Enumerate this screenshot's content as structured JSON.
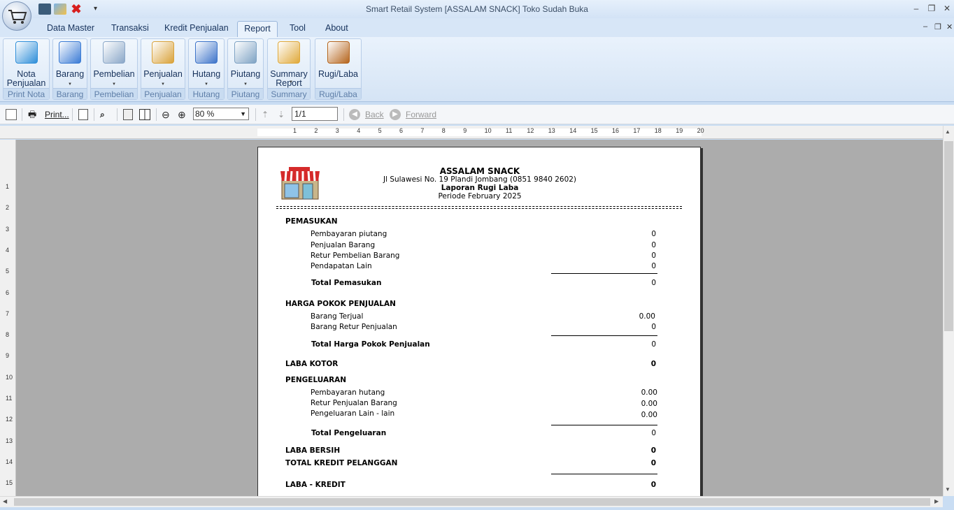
{
  "window": {
    "title": "Smart Retail System [ASSALAM SNACK] Toko Sudah Buka",
    "minimize": "–",
    "restore": "❐",
    "close": "✕",
    "qat_dropdown": "▾"
  },
  "tabs": [
    {
      "label": "Data Master"
    },
    {
      "label": "Transaksi"
    },
    {
      "label": "Kredit Penjualan"
    },
    {
      "label": "Report",
      "active": true
    },
    {
      "label": "Tool"
    },
    {
      "label": "About"
    }
  ],
  "mdi": {
    "minimize": "–",
    "restore": "❐",
    "close": "✕"
  },
  "ribbon": {
    "groups": [
      {
        "line1": "Nota",
        "line2": "Penjualan",
        "name": "Print Nota",
        "dropdown": false,
        "icon": "nota-icon",
        "color": "#2f8fd9"
      },
      {
        "line1": "Barang",
        "line2": "",
        "name": "Barang",
        "dropdown": true,
        "icon": "clipboard-icon",
        "color": "#3a7bd5"
      },
      {
        "line1": "Pembelian",
        "line2": "",
        "name": "Pembelian",
        "dropdown": true,
        "icon": "bar-chart-icon",
        "color": "#8aa7c8"
      },
      {
        "line1": "Penjualan",
        "line2": "",
        "name": "Penjualan",
        "dropdown": true,
        "icon": "sales-chart-icon",
        "color": "#d9a23a"
      },
      {
        "line1": "Hutang",
        "line2": "",
        "name": "Hutang",
        "dropdown": true,
        "icon": "debt-icon",
        "color": "#3d74c9"
      },
      {
        "line1": "Piutang",
        "line2": "",
        "name": "Piutang",
        "dropdown": true,
        "icon": "ledger-icon",
        "color": "#7fa3c4"
      },
      {
        "line1": "Summary",
        "line2": "Report",
        "name": "Summary",
        "dropdown": true,
        "icon": "summary-icon",
        "color": "#e0a93a"
      },
      {
        "line1": "Rugi/Laba",
        "line2": "",
        "name": "Rugi/Laba",
        "dropdown": false,
        "icon": "money-bag-icon",
        "color": "#b5651d"
      }
    ],
    "dropdown_glyph": "▾"
  },
  "toolbar": {
    "print_label": "Print...",
    "zoom_value": "80 %",
    "page_value": "1/1",
    "back_label": "Back",
    "forward_label": "Forward"
  },
  "ruler": {
    "h_numbers": [
      "1",
      "2",
      "3",
      "4",
      "5",
      "6",
      "7",
      "8",
      "9",
      "10",
      "11",
      "12",
      "13",
      "14",
      "15",
      "16",
      "17",
      "18",
      "19",
      "20"
    ],
    "v_numbers": [
      "1",
      "2",
      "3",
      "4",
      "5",
      "6",
      "7",
      "8",
      "9",
      "10",
      "11",
      "12",
      "13",
      "14",
      "15"
    ]
  },
  "report": {
    "store_name": "ASSALAM SNACK",
    "address": "Jl Sulawesi No. 19 Plandi Jombang (0851 9840 2602)",
    "title": "Laporan Rugi Laba",
    "period": "Periode February 2025",
    "pemasukan": {
      "heading": "PEMASUKAN",
      "items": [
        {
          "label": "Pembayaran piutang",
          "value": "0"
        },
        {
          "label": "Penjualan Barang",
          "value": "0"
        },
        {
          "label": "Retur Pembelian Barang",
          "value": "0"
        },
        {
          "label": "Pendapatan Lain",
          "value": "0"
        }
      ],
      "total_label": "Total Pemasukan",
      "total_value": "0"
    },
    "hpp": {
      "heading": "HARGA POKOK PENJUALAN",
      "items": [
        {
          "label": "Barang Terjual",
          "value": "0.00"
        },
        {
          "label": "Barang Retur Penjualan",
          "value": "0"
        }
      ],
      "total_label": "Total Harga Pokok Penjualan",
      "total_value": "0"
    },
    "laba_kotor": {
      "label": "LABA KOTOR",
      "value": "0"
    },
    "pengeluaran": {
      "heading": "PENGELUARAN",
      "items": [
        {
          "label": "Pembayaran hutang",
          "value": "0.00"
        },
        {
          "label": "Retur Penjualan Barang",
          "value": "0.00"
        },
        {
          "label": "Pengeluaran Lain - lain",
          "value": "0.00"
        }
      ],
      "total_label": "Total Pengeluaran",
      "total_value": "0"
    },
    "laba_bersih": {
      "label": "LABA BERSIH",
      "value": "0"
    },
    "total_kredit": {
      "label": "TOTAL KREDIT PELANGGAN",
      "value": "0"
    },
    "laba_kredit": {
      "label": "LABA - KREDIT",
      "value": "0"
    }
  }
}
